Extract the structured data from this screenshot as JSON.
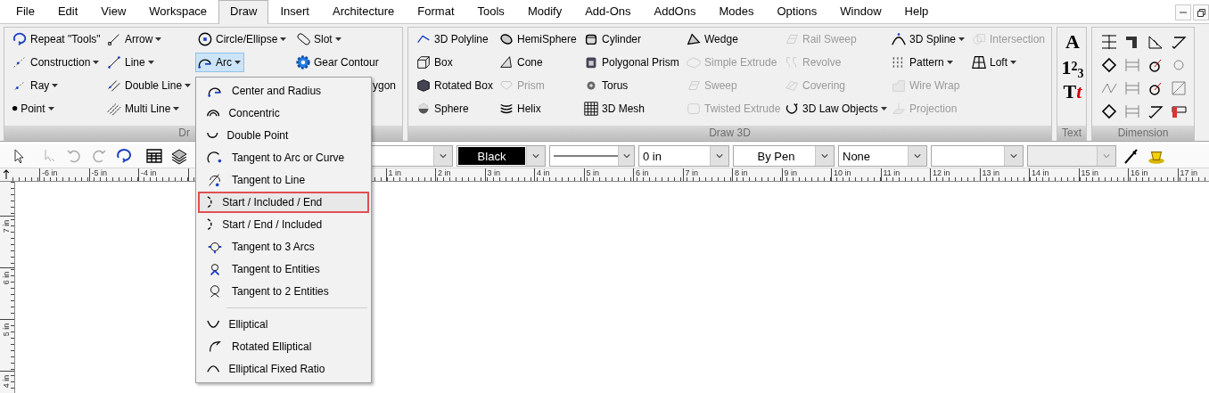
{
  "menu_bar": {
    "items": [
      {
        "label": "File",
        "selected": false
      },
      {
        "label": "Edit",
        "selected": false
      },
      {
        "label": "View",
        "selected": false
      },
      {
        "label": "Workspace",
        "selected": false
      },
      {
        "label": "Draw",
        "selected": true
      },
      {
        "label": "Insert",
        "selected": false
      },
      {
        "label": "Architecture",
        "selected": false
      },
      {
        "label": "Format",
        "selected": false
      },
      {
        "label": "Tools",
        "selected": false
      },
      {
        "label": "Modify",
        "selected": false
      },
      {
        "label": "Add-Ons",
        "selected": false
      },
      {
        "label": "AddOns",
        "selected": false
      },
      {
        "label": "Modes",
        "selected": false
      },
      {
        "label": "Options",
        "selected": false
      },
      {
        "label": "Window",
        "selected": false
      },
      {
        "label": "Help",
        "selected": false
      }
    ]
  },
  "ribbon": {
    "panels": [
      {
        "title": "Dr",
        "kind": "tools",
        "columns": [
          [
            {
              "label": "Repeat \"Tools\"",
              "dropdown": false,
              "disabled": false
            },
            {
              "label": "Construction",
              "dropdown": true,
              "disabled": false
            },
            {
              "label": "Ray",
              "dropdown": true,
              "disabled": false
            },
            {
              "label": "Point",
              "dropdown": true,
              "disabled": false
            }
          ],
          [
            {
              "label": "Arrow",
              "dropdown": true,
              "disabled": false
            },
            {
              "label": "Line",
              "dropdown": true,
              "disabled": false
            },
            {
              "label": "Double Line",
              "dropdown": true,
              "disabled": false
            },
            {
              "label": "Multi Line",
              "dropdown": true,
              "disabled": false
            }
          ],
          [
            {
              "label": "Circle/Ellipse",
              "dropdown": true,
              "disabled": false
            },
            {
              "label": "Arc",
              "dropdown": true,
              "disabled": false,
              "menu": {
                "items": [
                  {
                    "kind": "item",
                    "label": "Center and Radius",
                    "selected": false
                  },
                  {
                    "kind": "item",
                    "label": "Concentric",
                    "selected": false
                  },
                  {
                    "kind": "item",
                    "label": "Double Point",
                    "selected": false
                  },
                  {
                    "kind": "item",
                    "label": "Tangent to Arc or Curve",
                    "selected": false
                  },
                  {
                    "kind": "item",
                    "label": "Tangent to Line",
                    "selected": false
                  },
                  {
                    "kind": "item",
                    "label": "Start / Included / End",
                    "selected": true
                  },
                  {
                    "kind": "item",
                    "label": "Start / End / Included",
                    "selected": false
                  },
                  {
                    "kind": "item",
                    "label": "Tangent to 3 Arcs",
                    "selected": false
                  },
                  {
                    "kind": "item",
                    "label": "Tangent to Entities",
                    "selected": false
                  },
                  {
                    "kind": "item",
                    "label": "Tangent to 2 Entities",
                    "selected": false
                  },
                  {
                    "kind": "separator"
                  },
                  {
                    "kind": "item",
                    "label": "Elliptical",
                    "selected": false
                  },
                  {
                    "kind": "item",
                    "label": "Rotated Elliptical",
                    "selected": false
                  },
                  {
                    "kind": "item",
                    "label": "Elliptical Fixed Ratio",
                    "selected": false
                  }
                ]
              }
            }
          ],
          [
            {
              "label": "Slot",
              "dropdown": true,
              "disabled": false
            },
            {
              "label": "Gear Contour",
              "dropdown": false,
              "disabled": false
            },
            {
              "label": "ygon",
              "dropdown": false,
              "disabled": false
            }
          ]
        ]
      },
      {
        "title": "Draw 3D",
        "kind": "tools",
        "columns": [
          [
            {
              "label": "3D Polyline",
              "dropdown": false,
              "disabled": false
            },
            {
              "label": "Box",
              "dropdown": false,
              "disabled": false
            },
            {
              "label": "Rotated Box",
              "dropdown": false,
              "disabled": false
            },
            {
              "label": "Sphere",
              "dropdown": false,
              "disabled": false
            }
          ],
          [
            {
              "label": "HemiSphere",
              "dropdown": false,
              "disabled": false
            },
            {
              "label": "Cone",
              "dropdown": false,
              "disabled": false
            },
            {
              "label": "Prism",
              "dropdown": false,
              "disabled": true
            },
            {
              "label": "Helix",
              "dropdown": false,
              "disabled": false
            }
          ],
          [
            {
              "label": "Cylinder",
              "dropdown": false,
              "disabled": false
            },
            {
              "label": "Polygonal Prism",
              "dropdown": false,
              "disabled": false
            },
            {
              "label": "Torus",
              "dropdown": false,
              "disabled": false
            },
            {
              "label": "3D Mesh",
              "dropdown": false,
              "disabled": false
            }
          ],
          [
            {
              "label": "Wedge",
              "dropdown": false,
              "disabled": false
            },
            {
              "label": "Simple Extrude",
              "dropdown": false,
              "disabled": true
            },
            {
              "label": "Sweep",
              "dropdown": false,
              "disabled": true
            },
            {
              "label": "Twisted Extrude",
              "dropdown": false,
              "disabled": true
            }
          ],
          [
            {
              "label": "Rail Sweep",
              "dropdown": false,
              "disabled": true
            },
            {
              "label": "Revolve",
              "dropdown": false,
              "disabled": true
            },
            {
              "label": "Covering",
              "dropdown": false,
              "disabled": true
            },
            {
              "label": "3D Law Objects",
              "dropdown": true,
              "disabled": false
            }
          ],
          [
            {
              "label": "3D Spline",
              "dropdown": true,
              "disabled": false
            },
            {
              "label": "Pattern",
              "dropdown": true,
              "disabled": false
            },
            {
              "label": "Wire Wrap",
              "dropdown": false,
              "disabled": true
            },
            {
              "label": "Projection",
              "dropdown": false,
              "disabled": true
            }
          ],
          [
            {
              "label": "Intersection",
              "dropdown": false,
              "disabled": true
            },
            {
              "label": "Loft",
              "dropdown": true,
              "disabled": false
            }
          ]
        ]
      },
      {
        "title": "Text",
        "kind": "glyphs",
        "buttons": [
          {
            "glyph": "A"
          },
          {
            "glyph": "1$^{2}$$_{3}$"
          },
          {
            "glyph": "T",
            "accent": "t"
          }
        ]
      },
      {
        "title": "Dimension",
        "kind": "icons",
        "buttons": [
          {
            "disabled": false
          },
          {
            "disabled": false
          },
          {
            "disabled": false
          },
          {
            "disabled": false
          },
          {
            "disabled": false
          },
          {
            "disabled": true
          },
          {
            "disabled": false
          },
          {
            "disabled": true
          },
          {
            "disabled": true
          },
          {
            "disabled": true
          },
          {
            "disabled": false
          },
          {
            "disabled": true
          },
          {
            "disabled": false
          },
          {
            "disabled": true
          },
          {
            "disabled": false
          },
          {
            "disabled": false
          }
        ]
      }
    ]
  },
  "toolbar": {
    "buttons": [
      {
        "disabled": false
      },
      {
        "disabled": true
      },
      {
        "disabled": true
      },
      {
        "disabled": true
      },
      {
        "disabled": false
      },
      {
        "disabled": false
      },
      {
        "disabled": false
      }
    ],
    "combos": [
      {
        "kind": "text",
        "disabled": false
      },
      {
        "kind": "color",
        "value": "Black",
        "color": "#000000",
        "disabled": false
      },
      {
        "kind": "linestyle",
        "disabled": false
      },
      {
        "kind": "text",
        "value": "0 in",
        "disabled": false
      },
      {
        "kind": "centered",
        "value": "By Pen",
        "disabled": false
      },
      {
        "kind": "text",
        "value": "None",
        "disabled": false
      },
      {
        "kind": "text",
        "disabled": false
      },
      {
        "kind": "text",
        "disabled": true
      }
    ]
  },
  "ruler": {
    "left_labels": [
      "-6 in",
      "-5 in",
      "-4 in"
    ],
    "right_labels": [
      "1 in",
      "2 in",
      "3 in",
      "4 in",
      "5 in",
      "6 in",
      "7 in",
      "8 in",
      "9 in",
      "10 in",
      "11 in",
      "12 in",
      "13 in",
      "14 in",
      "15 in",
      "16 in",
      "17 in"
    ],
    "vertical_labels": [
      "7 in",
      "6 in",
      "5 in",
      "4 in"
    ]
  }
}
